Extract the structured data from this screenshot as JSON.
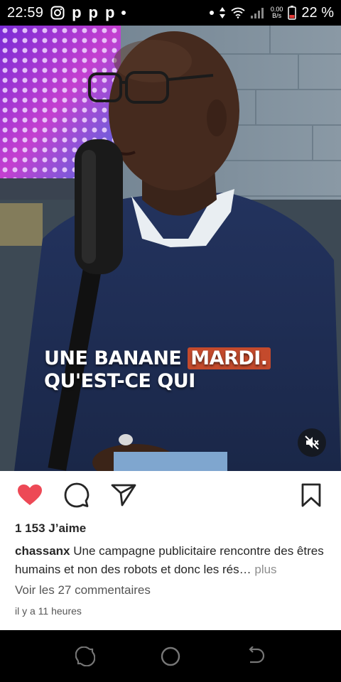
{
  "status_bar": {
    "time": "22:59",
    "net_speed_value": "0.00",
    "net_speed_unit": "B/s",
    "battery": "22 %",
    "icons": [
      "instagram-icon",
      "p-icon",
      "p-icon",
      "p-icon",
      "dot-icon",
      "dot-icon",
      "data-arrows-icon",
      "wifi-icon",
      "signal-icon",
      "battery-icon"
    ],
    "p_letter": "p"
  },
  "video": {
    "caption_line1_pre": "UNE BANANE ",
    "caption_line1_highlight": "MARDI.",
    "caption_line2": "QU'EST-CE QUI",
    "highlight_color": "#c44a2c",
    "muted": true
  },
  "post": {
    "likes": "1 153 J’aime",
    "username": "chassanx",
    "caption": "Une campagne publicitaire rencontre des êtres humains et non des robots et donc les rés…",
    "more_label": "plus",
    "comments_link": "Voir les 27 commentaires",
    "time_ago": "il y a 11 heures",
    "liked": true,
    "like_color": "#ed4956"
  }
}
